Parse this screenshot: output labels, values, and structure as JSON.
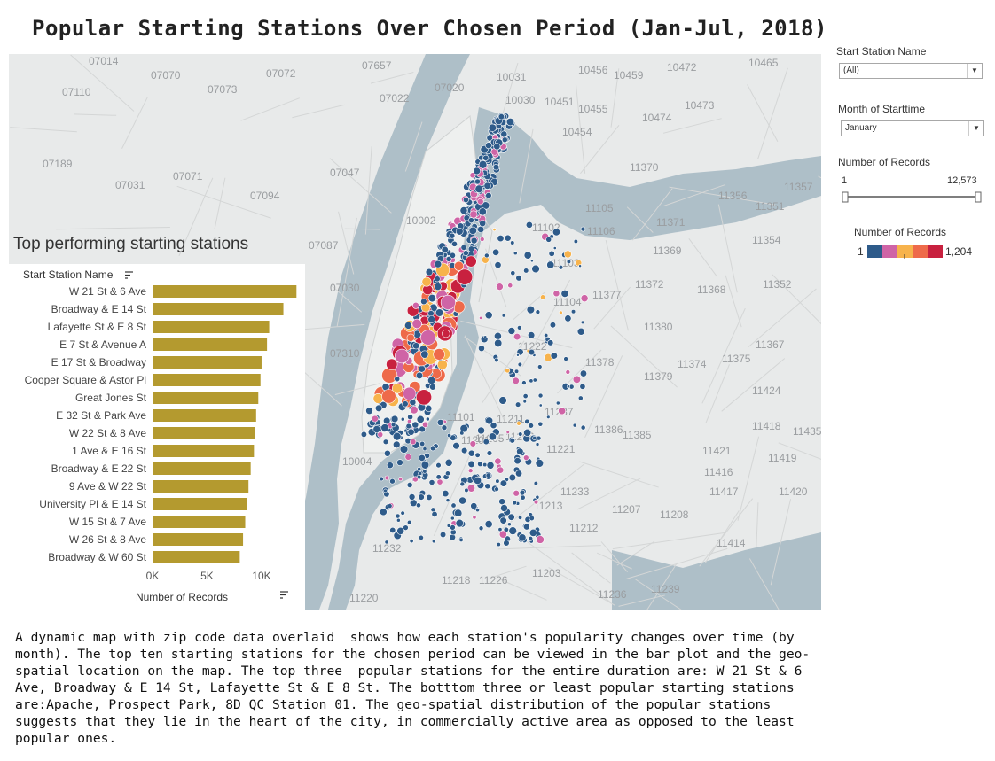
{
  "title": "Popular Starting Stations Over Chosen Period (Jan-Jul, 2018)",
  "bar_panel_title": "Top performing starting stations",
  "filters": {
    "station_label": "Start Station Name",
    "station_value": "(All)",
    "month_label": "Month of Starttime",
    "month_value": "January",
    "records_label": "Number of Records",
    "records_min": "1",
    "records_max": "12,573",
    "slider_low_fraction": 0.0,
    "slider_high_fraction": 1.0,
    "legend_label": "Number of Records",
    "legend_min": "1",
    "legend_max": "1,204",
    "legend_colors": [
      "#2e5b8a",
      "#cf64a6",
      "#f7b34c",
      "#ee6a4a",
      "#c8213f"
    ]
  },
  "map": {
    "zip_labels": [
      "07014",
      "07070",
      "07072",
      "07657",
      "10456",
      "10472",
      "10465",
      "07110",
      "07073",
      "07020",
      "10031",
      "10459",
      "07022",
      "10030",
      "10451",
      "10455",
      "10473",
      "10474",
      "10454",
      "07189",
      "07071",
      "07047",
      "11370",
      "11356",
      "11357",
      "07031",
      "07094",
      "11105",
      "11351",
      "11371",
      "11354",
      "07087",
      "11369",
      "11372",
      "11368",
      "11352",
      "07030",
      "11377",
      "11104",
      "11380",
      "11367",
      "07310",
      "11374",
      "11375",
      "11378",
      "11379",
      "11424",
      "11237",
      "11418",
      "11386",
      "11385",
      "11435",
      "11221",
      "11421",
      "11419",
      "11416",
      "11417",
      "11420",
      "10004",
      "11233",
      "11213",
      "11207",
      "11208",
      "11414",
      "11232",
      "11212",
      "11203",
      "11218",
      "11226",
      "11236",
      "11220",
      "11239",
      "11106",
      "10002",
      "11101",
      "11211",
      "11201",
      "11205",
      "11206",
      "11222",
      "11102",
      "11103"
    ]
  },
  "chart_data": {
    "type": "bar",
    "orientation": "horizontal",
    "dimension_label": "Start Station Name",
    "xlabel": "Number of Records",
    "categories": [
      "W 21 St & 6 Ave",
      "Broadway & E 14 St",
      "Lafayette St & E 8 St",
      "E 7 St & Avenue A",
      "E 17 St & Broadway",
      "Cooper Square & Astor Pl",
      "Great Jones St",
      "E 32 St & Park Ave",
      "W 22 St & 8 Ave",
      "1 Ave & E 16 St",
      "Broadway & E 22 St",
      "9 Ave & W 22 St",
      "University Pl & E 14 St",
      "W 15 St & 7 Ave",
      "W 26 St & 8 Ave",
      "Broadway & W 60 St"
    ],
    "values": [
      13200,
      12000,
      10700,
      10500,
      10000,
      9900,
      9700,
      9500,
      9400,
      9300,
      9000,
      8800,
      8700,
      8500,
      8300,
      8000
    ],
    "xticks": [
      "0K",
      "5K",
      "10K"
    ],
    "xlim": [
      0,
      13500
    ],
    "bar_color": "#b49a2f"
  },
  "description": "A dynamic map with zip code data overlaid  shows how each station's popularity changes over time (by month). The top ten starting stations for the chosen period can be viewed in the bar plot and the geo-spatial location on the map. The top three  popular stations for the entire duration are: W 21 St & 6 Ave, Broadway & E 14 St, Lafayette St & E 8 St. The botttom three or least popular starting stations are:Apache, Prospect Park, 8D QC Station 01. The geo-spatial distribution of the popular stations suggests that they lie in the heart of the city, in commercially active area as opposed to the least popular ones."
}
